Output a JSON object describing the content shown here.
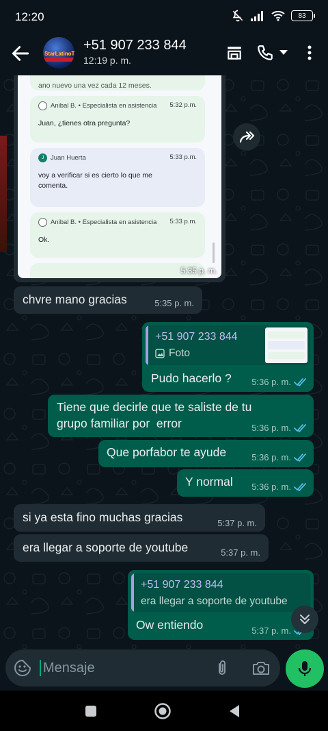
{
  "status_bar": {
    "time": "12:20",
    "battery": "83"
  },
  "header": {
    "contact_name": "+51 907 233 844",
    "contact_status": "12:19 p. m.",
    "avatar_logo_text": "StarLatinoTV"
  },
  "photo_message": {
    "cropped_top_text": "ano nuevo una vez cada 12 meses.",
    "cards": [
      {
        "author": "Anibal B. • Especialista en asistencia",
        "time": "5:32 p.m.",
        "body": "Juan, ¿tienes otra pregunta?"
      },
      {
        "author": "Juan Huerta",
        "initial": "J",
        "time": "5:33 p.m.",
        "body": "voy a verificar si es cierto lo que me comenta."
      },
      {
        "author": "Anibal B. • Especialista en asistencia",
        "time": "5:33 p.m.",
        "body": "Ok."
      }
    ],
    "time": "5:35 p. m."
  },
  "messages": [
    {
      "direction": "in",
      "text": "chvre mano gracias",
      "time": "5:35 p. m."
    },
    {
      "direction": "out",
      "quote_name": "+51 907 233 844",
      "quote_sub": "Foto",
      "text": "Pudo hacerlo ?",
      "time": "5:36 p. m."
    },
    {
      "direction": "out",
      "text_line1": "Tiene que decirle que te saliste de tu",
      "text_line2": "grupo familiar por  error",
      "time": "5:36 p. m."
    },
    {
      "direction": "out",
      "text": "Que porfabor te ayude",
      "time": "5:36 p. m."
    },
    {
      "direction": "out",
      "text": "Y normal",
      "time": "5:36 p. m."
    },
    {
      "direction": "in",
      "text": "si ya esta fino muchas gracias",
      "time": "5:37 p. m."
    },
    {
      "direction": "in",
      "text": "era llegar a soporte de youtube",
      "time": "5:37 p. m."
    },
    {
      "direction": "out",
      "quote_name": "+51 907 233 844",
      "quote_sub": "era llegar a soporte de youtube",
      "text": "Ow entiendo",
      "time": "5:37 p. m."
    }
  ],
  "composer": {
    "placeholder": "Mensaje"
  },
  "colors": {
    "background": "#0b141a",
    "incoming_bubble": "#202c33",
    "outgoing_bubble": "#005c4b",
    "accent": "#00a884",
    "mic_button": "#21c063",
    "read_ticks": "#53bdeb"
  },
  "icons": [
    "mute-icon",
    "signal-icon",
    "wifi-icon",
    "battery-icon",
    "back-arrow-icon",
    "store-icon",
    "phone-icon",
    "dropdown-icon",
    "more-vert-icon",
    "forward-icon",
    "double-check-icon",
    "image-icon",
    "scroll-down-icon",
    "sticker-icon",
    "attach-icon",
    "camera-icon",
    "mic-icon",
    "recents-icon",
    "home-icon",
    "back-icon"
  ]
}
